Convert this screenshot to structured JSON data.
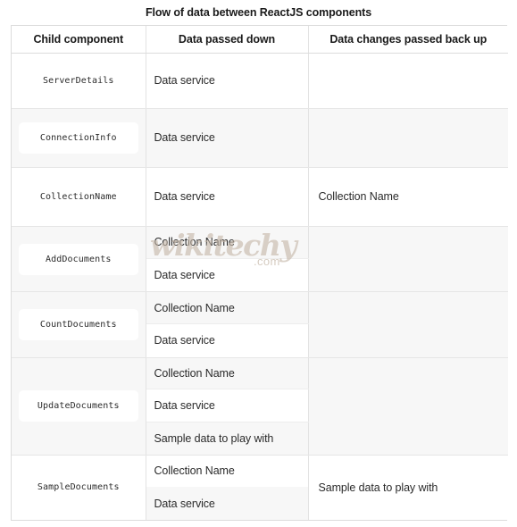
{
  "figure": {
    "title": "Flow of data between ReactJS components"
  },
  "table": {
    "headers": [
      "Child component",
      "Data passed down",
      "Data changes passed back up"
    ],
    "rows": [
      {
        "component": "ServerDetails",
        "passed_down": [
          "Data service"
        ],
        "passed_back_up": ""
      },
      {
        "component": "ConnectionInfo",
        "passed_down": [
          "Data service"
        ],
        "passed_back_up": ""
      },
      {
        "component": "CollectionName",
        "passed_down": [
          "Data service"
        ],
        "passed_back_up": "Collection Name"
      },
      {
        "component": "AddDocuments",
        "passed_down": [
          "Collection Name",
          "Data service"
        ],
        "passed_back_up": ""
      },
      {
        "component": "CountDocuments",
        "passed_down": [
          "Collection Name",
          "Data service"
        ],
        "passed_back_up": ""
      },
      {
        "component": "UpdateDocuments",
        "passed_down": [
          "Collection Name",
          "Data service",
          "Sample data to play with"
        ],
        "passed_back_up": ""
      },
      {
        "component": "SampleDocuments",
        "passed_down": [
          "Collection Name",
          "Data service"
        ],
        "passed_back_up": "Sample data to play with"
      }
    ]
  },
  "watermark": {
    "main": "wikitechy",
    "sub": ".com"
  },
  "colors": {
    "border": "#dcdcdc",
    "inner_border": "#ededed",
    "stripe": "#f7f7f7",
    "text": "#2b2b2b",
    "watermark": "#c5b7a8"
  }
}
